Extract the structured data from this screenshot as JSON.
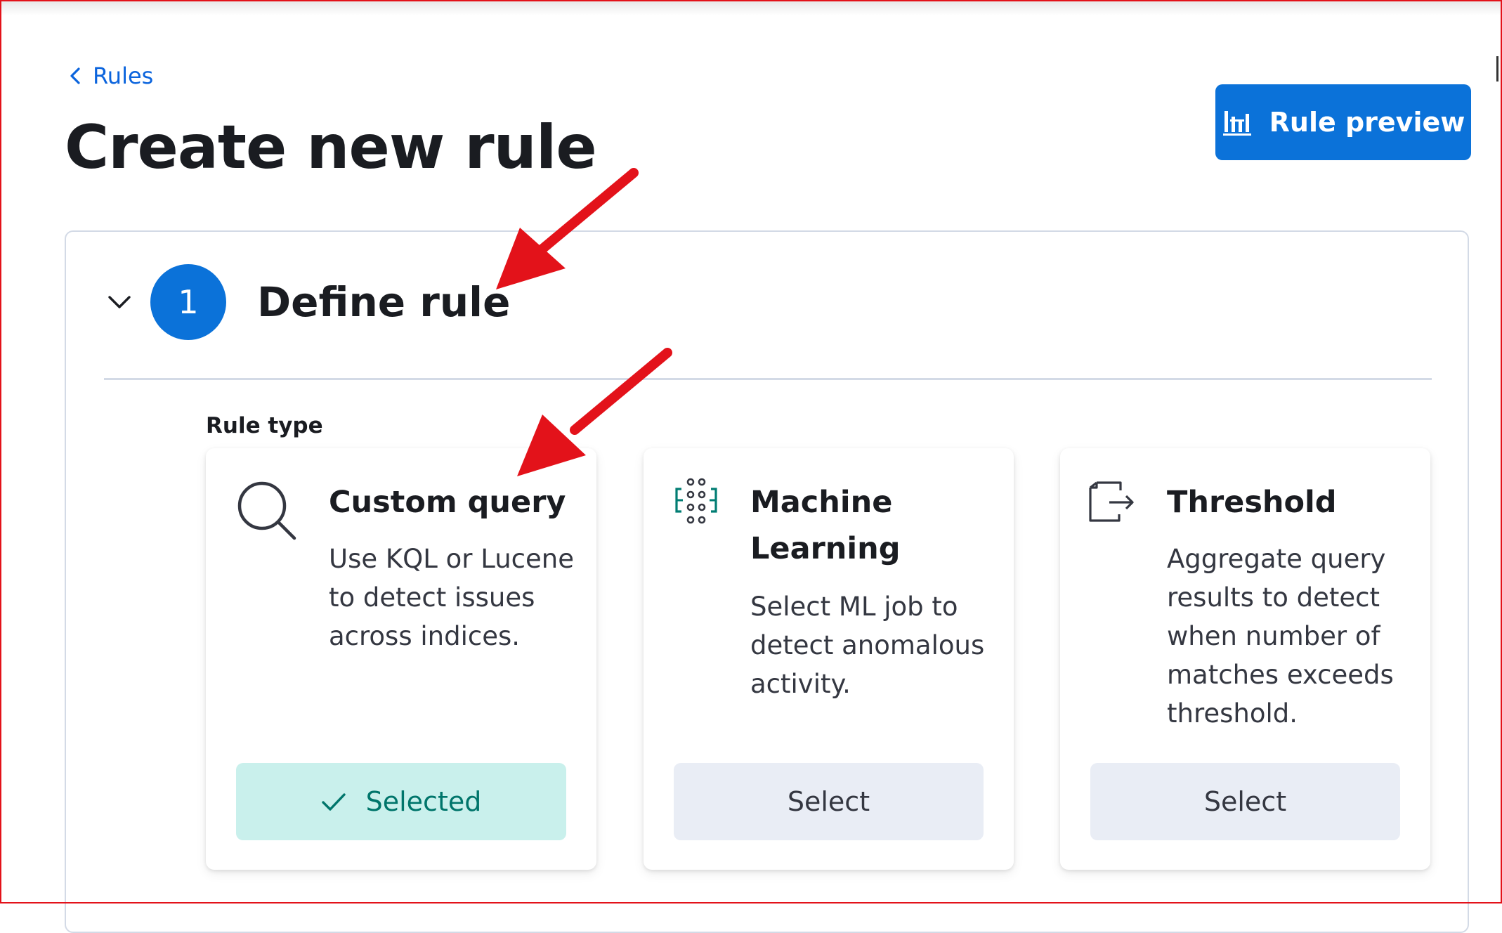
{
  "breadcrumb": {
    "label": "Rules",
    "icon": "chevron-left-icon"
  },
  "page": {
    "title": "Create new rule"
  },
  "header": {
    "preview_button": {
      "label": "Rule preview",
      "icon": "chart-bars-icon"
    }
  },
  "step": {
    "number": "1",
    "title": "Define rule",
    "toggle_icon": "chevron-down-icon",
    "rule_type_label": "Rule type"
  },
  "rule_types": [
    {
      "title": "Custom query",
      "description": "Use KQL or Lucene to detect issues across indices.",
      "button_label": "Selected",
      "selected": true,
      "icon": "magnifier-icon"
    },
    {
      "title": "Machine Learning",
      "description": "Select ML job to detect anomalous activity.",
      "button_label": "Select",
      "selected": false,
      "icon": "machine-learning-icon"
    },
    {
      "title": "Threshold",
      "description": "Aggregate query results to detect when number of matches exceeds threshold.",
      "button_label": "Select",
      "selected": false,
      "icon": "threshold-icon"
    }
  ],
  "colors": {
    "primary": "#0b72d9",
    "link": "#0b64dd",
    "selected_bg": "#c9f0ec",
    "selected_text": "#00756b",
    "select_bg": "#e9edf5",
    "annotation_arrow": "#e3121a",
    "ml_icon": "#017d73"
  }
}
